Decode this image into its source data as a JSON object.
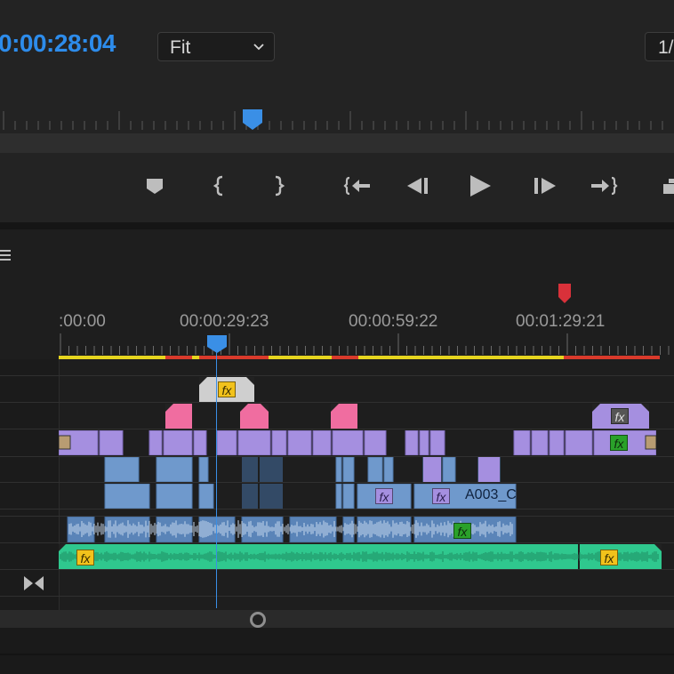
{
  "monitor": {
    "timecode": "0:00:28:04",
    "fit_select": {
      "value": "Fit"
    },
    "resolution_select": {
      "value": "1/"
    }
  },
  "transport": {
    "buttons": [
      "add-marker",
      "mark-in",
      "mark-out",
      "go-to-in",
      "step-back",
      "play",
      "step-forward",
      "go-to-out",
      "lift"
    ]
  },
  "timeline": {
    "ruler_labels": [
      ":00:00",
      "00:00:29:23",
      "00:00:59:22",
      "00:01:29:21"
    ],
    "clip_label": "A003_C",
    "fx_label": "fx",
    "playhead_fraction": 0.26,
    "colors": {
      "playhead": "#3a8fe6",
      "marker": "#d9313a",
      "render_yellow": "#e6d51f",
      "render_red": "#d93a2b",
      "video_purple": "#a58fe0",
      "video_blue": "#6f99cc",
      "audio_green": "#2fc88e",
      "pink": "#f06da0"
    }
  }
}
